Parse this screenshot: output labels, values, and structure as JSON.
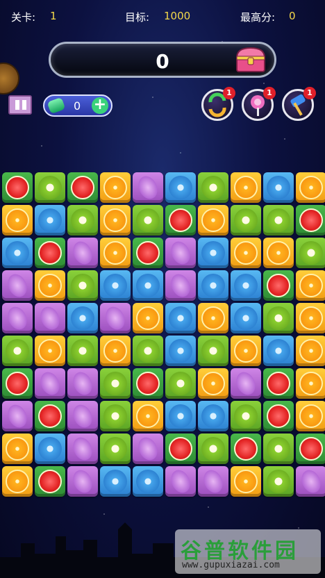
{
  "hud": {
    "level_label": "关卡:",
    "level_value": "1",
    "target_label": "目标:",
    "target_value": "1000",
    "best_label": "最高分:",
    "best_value": "0"
  },
  "score": "0",
  "gems": "0",
  "tools": [
    {
      "name": "shuffle-icon",
      "badge": "1"
    },
    {
      "name": "lollipop-icon",
      "badge": "1"
    },
    {
      "name": "hammer-icon",
      "badge": "1"
    }
  ],
  "board": [
    [
      "watermelon",
      "kiwi",
      "watermelon",
      "orange",
      "grape",
      "blueberry",
      "kiwi",
      "orange",
      "blueberry",
      "orange"
    ],
    [
      "orange",
      "blueberry",
      "kiwi",
      "orange",
      "kiwi",
      "watermelon",
      "orange",
      "kiwi",
      "kiwi",
      "watermelon"
    ],
    [
      "blueberry",
      "watermelon",
      "grape",
      "orange",
      "watermelon",
      "grape",
      "blueberry",
      "orange",
      "orange",
      "kiwi"
    ],
    [
      "grape",
      "orange",
      "kiwi",
      "blueberry",
      "blueberry",
      "grape",
      "blueberry",
      "blueberry",
      "watermelon",
      "orange"
    ],
    [
      "grape",
      "grape",
      "blueberry",
      "grape",
      "orange",
      "blueberry",
      "orange",
      "blueberry",
      "kiwi",
      "orange"
    ],
    [
      "kiwi",
      "orange",
      "kiwi",
      "orange",
      "kiwi",
      "blueberry",
      "kiwi",
      "orange",
      "blueberry",
      "orange"
    ],
    [
      "watermelon",
      "grape",
      "grape",
      "kiwi",
      "watermelon",
      "kiwi",
      "orange",
      "grape",
      "watermelon",
      "orange"
    ],
    [
      "grape",
      "watermelon",
      "grape",
      "kiwi",
      "orange",
      "blueberry",
      "blueberry",
      "kiwi",
      "watermelon",
      "orange"
    ],
    [
      "orange",
      "blueberry",
      "grape",
      "kiwi",
      "grape",
      "watermelon",
      "kiwi",
      "watermelon",
      "kiwi",
      "watermelon"
    ],
    [
      "orange",
      "watermelon",
      "grape",
      "blueberry",
      "blueberry",
      "grape",
      "grape",
      "orange",
      "kiwi",
      "grape"
    ]
  ],
  "watermark": {
    "title": "谷普软件园",
    "url": "www.gupuxiazai.com"
  }
}
